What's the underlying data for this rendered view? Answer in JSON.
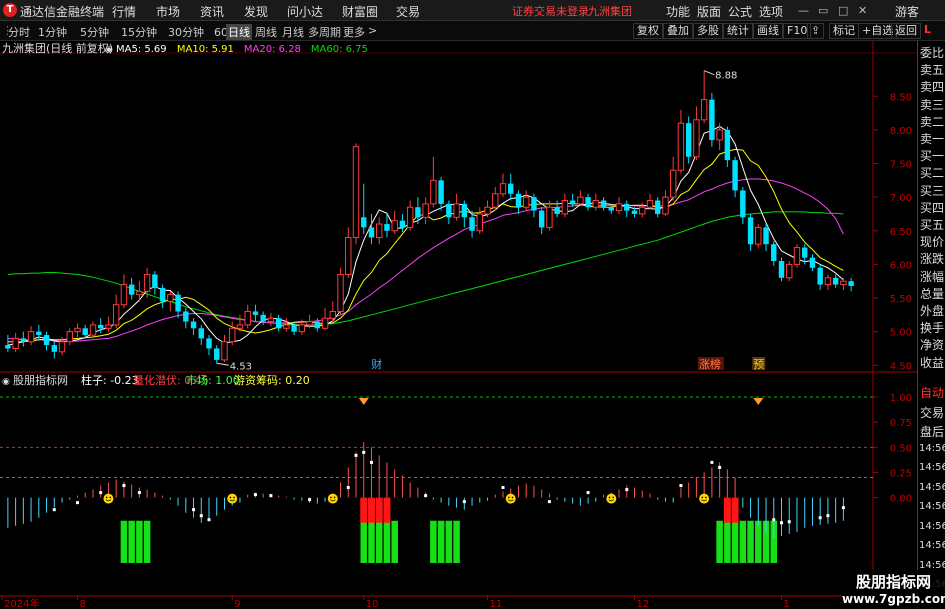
{
  "app": {
    "logo": "T",
    "name": "通达信金融终端"
  },
  "menu": [
    "行情",
    "市场",
    "资讯",
    "发现",
    "问小达",
    "财富圈",
    "交易"
  ],
  "warning": "证券交易未登录",
  "stock_name_top": "九洲集团",
  "right_menu": [
    "功能",
    "版面",
    "公式",
    "选项"
  ],
  "guest": "游客",
  "periods": [
    "分时",
    "1分钟",
    "5分钟",
    "15分钟",
    "30分钟",
    "60分钟",
    "日线",
    "周线",
    "月线",
    "多周期",
    "更多"
  ],
  "selected_period": "日线",
  "more_arrow": ">",
  "right_tools": [
    "复权",
    "叠加",
    "多股",
    "统计",
    "画线",
    "F10",
    "标记",
    "+自选",
    "返回"
  ],
  "chart_title": "九洲集团(日线 前复权)",
  "main_icon": "◉",
  "ma": [
    {
      "label": "MA5: 5.69",
      "color": "#ffffff"
    },
    {
      "label": "MA10: 5.91",
      "color": "#ffff00"
    },
    {
      "label": "MA20: 6.28",
      "color": "#ff40ff"
    },
    {
      "label": "MA60: 6.75",
      "color": "#00dd00"
    }
  ],
  "price_ticks": [
    "8.50",
    "8.00",
    "7.50",
    "7.00",
    "6.50",
    "6.00",
    "5.50",
    "5.00",
    "4.50"
  ],
  "high_label": "8.88",
  "low_label": "4.53",
  "markers": {
    "cai": "财",
    "zhangting": "涨榜",
    "yu": "预"
  },
  "indicator": {
    "name": "股朋指标网",
    "zhuzi": "柱子: -0.23",
    "lh": "量化潜伏: 0.45",
    "sc": "市场: 1.00",
    "yz": "游资筹码: 0.20"
  },
  "ind_ticks": [
    "1.00",
    "0.75",
    "0.50",
    "0.25",
    "0.00"
  ],
  "xaxis": [
    "2024年",
    "8",
    "9",
    "10",
    "11",
    "12",
    "1"
  ],
  "right_panel": [
    "委比",
    "卖五",
    "卖四",
    "卖三",
    "卖二",
    "卖一",
    "买一",
    "买二",
    "买三",
    "买四",
    "买五",
    "现价",
    "涨跌",
    "涨幅",
    "总量",
    "外盘",
    "换手",
    "净资",
    "收益"
  ],
  "right_panel2": [
    "自动",
    "交易",
    "盘后",
    "14:56",
    "14:56",
    "14:56",
    "14:56",
    "14:56",
    "14:56",
    "14:56",
    "14:56"
  ],
  "watermark": {
    "line1": "股朋指标网",
    "line2": "www.7gpzb.com"
  },
  "chart_data": {
    "type": "candlestick",
    "title": "九洲集团(日线 前复权)",
    "ylim": [
      4.4,
      8.95
    ],
    "high": 8.88,
    "low": 4.53,
    "candles": [
      [
        4.8,
        4.75,
        4.95,
        4.7
      ],
      [
        4.75,
        4.9,
        4.98,
        4.7
      ],
      [
        4.9,
        4.85,
        5.0,
        4.78
      ],
      [
        4.85,
        5.0,
        5.08,
        4.8
      ],
      [
        5.0,
        4.95,
        5.1,
        4.88
      ],
      [
        4.95,
        4.8,
        5.0,
        4.72
      ],
      [
        4.8,
        4.7,
        4.85,
        4.6
      ],
      [
        4.7,
        4.85,
        4.92,
        4.65
      ],
      [
        4.85,
        5.0,
        5.05,
        4.8
      ],
      [
        5.0,
        5.05,
        5.12,
        4.92
      ],
      [
        5.05,
        4.95,
        5.1,
        4.9
      ],
      [
        4.95,
        5.1,
        5.15,
        4.9
      ],
      [
        5.1,
        5.05,
        5.2,
        4.98
      ],
      [
        5.05,
        5.1,
        5.22,
        5.0
      ],
      [
        5.1,
        5.4,
        5.55,
        5.05
      ],
      [
        5.4,
        5.7,
        5.85,
        5.35
      ],
      [
        5.7,
        5.55,
        5.8,
        5.48
      ],
      [
        5.55,
        5.6,
        5.75,
        5.45
      ],
      [
        5.6,
        5.85,
        5.95,
        5.5
      ],
      [
        5.85,
        5.65,
        5.9,
        5.55
      ],
      [
        5.65,
        5.45,
        5.7,
        5.35
      ],
      [
        5.45,
        5.55,
        5.6,
        5.3
      ],
      [
        5.55,
        5.3,
        5.6,
        5.2
      ],
      [
        5.3,
        5.15,
        5.35,
        5.05
      ],
      [
        5.15,
        5.05,
        5.2,
        4.95
      ],
      [
        5.05,
        4.9,
        5.1,
        4.8
      ],
      [
        4.9,
        4.75,
        4.95,
        4.65
      ],
      [
        4.75,
        4.58,
        4.8,
        4.53
      ],
      [
        4.58,
        4.85,
        4.95,
        4.55
      ],
      [
        4.85,
        5.05,
        5.15,
        4.8
      ],
      [
        5.05,
        5.1,
        5.25,
        5.0
      ],
      [
        5.1,
        5.3,
        5.4,
        5.05
      ],
      [
        5.3,
        5.25,
        5.4,
        5.15
      ],
      [
        5.25,
        5.15,
        5.3,
        5.1
      ],
      [
        5.15,
        5.2,
        5.28,
        5.08
      ],
      [
        5.2,
        5.05,
        5.25,
        5.0
      ],
      [
        5.05,
        5.1,
        5.2,
        5.0
      ],
      [
        5.1,
        5.0,
        5.15,
        4.95
      ],
      [
        5.0,
        5.1,
        5.18,
        4.95
      ],
      [
        5.1,
        5.15,
        5.25,
        5.05
      ],
      [
        5.15,
        5.05,
        5.2,
        5.0
      ],
      [
        5.05,
        5.2,
        5.35,
        5.02
      ],
      [
        5.2,
        5.3,
        5.45,
        5.15
      ],
      [
        5.3,
        5.85,
        5.95,
        5.25
      ],
      [
        5.85,
        6.4,
        6.55,
        5.8
      ],
      [
        6.4,
        7.75,
        7.8,
        6.3
      ],
      [
        6.7,
        6.55,
        7.2,
        6.45
      ],
      [
        6.55,
        6.4,
        6.75,
        6.3
      ],
      [
        6.4,
        6.6,
        6.7,
        6.3
      ],
      [
        6.6,
        6.5,
        6.75,
        6.4
      ],
      [
        6.5,
        6.65,
        6.8,
        6.45
      ],
      [
        6.65,
        6.55,
        6.75,
        6.48
      ],
      [
        6.55,
        6.85,
        6.95,
        6.5
      ],
      [
        6.85,
        6.7,
        7.0,
        6.6
      ],
      [
        6.7,
        6.9,
        7.0,
        6.6
      ],
      [
        6.9,
        7.25,
        7.6,
        6.85
      ],
      [
        7.25,
        6.9,
        7.3,
        6.8
      ],
      [
        6.9,
        6.7,
        6.95,
        6.6
      ],
      [
        6.7,
        6.9,
        7.05,
        6.65
      ],
      [
        6.9,
        6.7,
        6.95,
        6.55
      ],
      [
        6.7,
        6.5,
        6.8,
        6.4
      ],
      [
        6.5,
        6.75,
        6.85,
        6.45
      ],
      [
        6.75,
        6.85,
        6.95,
        6.7
      ],
      [
        6.85,
        7.05,
        7.15,
        6.8
      ],
      [
        7.05,
        7.2,
        7.35,
        7.0
      ],
      [
        7.2,
        7.05,
        7.35,
        6.95
      ],
      [
        7.05,
        6.85,
        7.1,
        6.75
      ],
      [
        6.85,
        7.0,
        7.1,
        6.8
      ],
      [
        7.0,
        6.8,
        7.05,
        6.7
      ],
      [
        6.8,
        6.55,
        6.85,
        6.45
      ],
      [
        6.55,
        6.85,
        6.95,
        6.5
      ],
      [
        6.85,
        6.75,
        6.95,
        6.7
      ],
      [
        6.75,
        6.95,
        7.05,
        6.7
      ],
      [
        6.95,
        6.9,
        7.05,
        6.85
      ],
      [
        6.9,
        7.0,
        7.1,
        6.88
      ],
      [
        7.0,
        6.85,
        7.05,
        6.8
      ],
      [
        6.85,
        6.95,
        7.05,
        6.8
      ],
      [
        6.95,
        6.85,
        7.0,
        6.8
      ],
      [
        6.85,
        6.8,
        6.9,
        6.75
      ],
      [
        6.8,
        6.9,
        7.0,
        6.75
      ],
      [
        6.9,
        6.8,
        6.95,
        6.7
      ],
      [
        6.8,
        6.75,
        6.85,
        6.7
      ],
      [
        6.75,
        6.85,
        6.92,
        6.7
      ],
      [
        6.85,
        6.95,
        7.05,
        6.82
      ],
      [
        6.95,
        6.75,
        7.0,
        6.7
      ],
      [
        6.75,
        7.0,
        7.1,
        6.72
      ],
      [
        7.0,
        7.4,
        7.6,
        6.95
      ],
      [
        7.4,
        8.1,
        8.3,
        7.35
      ],
      [
        8.1,
        7.6,
        8.2,
        7.5
      ],
      [
        7.6,
        8.15,
        8.35,
        7.55
      ],
      [
        8.15,
        8.45,
        8.88,
        8.1
      ],
      [
        8.45,
        7.85,
        8.55,
        7.75
      ],
      [
        7.85,
        8.0,
        8.1,
        7.7
      ],
      [
        8.0,
        7.55,
        8.05,
        7.45
      ],
      [
        7.55,
        7.1,
        7.6,
        7.0
      ],
      [
        7.1,
        6.7,
        7.15,
        6.6
      ],
      [
        6.7,
        6.3,
        6.75,
        6.2
      ],
      [
        6.3,
        6.55,
        6.6,
        6.25
      ],
      [
        6.55,
        6.3,
        6.6,
        6.2
      ],
      [
        6.3,
        6.05,
        6.35,
        5.98
      ],
      [
        6.05,
        5.8,
        6.1,
        5.75
      ],
      [
        5.8,
        6.0,
        6.05,
        5.75
      ],
      [
        6.0,
        6.25,
        6.3,
        5.95
      ],
      [
        6.25,
        6.1,
        6.3,
        6.0
      ],
      [
        6.1,
        5.95,
        6.15,
        5.9
      ],
      [
        5.95,
        5.7,
        6.0,
        5.62
      ],
      [
        5.7,
        5.8,
        5.85,
        5.62
      ],
      [
        5.8,
        5.7,
        5.85,
        5.65
      ],
      [
        5.7,
        5.75,
        5.8,
        5.62
      ],
      [
        5.75,
        5.68,
        5.8,
        5.6
      ]
    ],
    "ma5": [
      4.8,
      4.82,
      4.85,
      4.88,
      4.92,
      4.9,
      4.86,
      4.85,
      4.86,
      4.88,
      4.91,
      4.98,
      5.03,
      5.06,
      5.13,
      5.26,
      5.36,
      5.47,
      5.62,
      5.67,
      5.62,
      5.61,
      5.5,
      5.41,
      5.3,
      5.19,
      5.03,
      4.9,
      4.83,
      4.85,
      4.87,
      4.95,
      5.07,
      5.17,
      5.2,
      5.19,
      5.15,
      5.1,
      5.09,
      5.08,
      5.08,
      5.1,
      5.16,
      5.31,
      5.56,
      6.04,
      6.36,
      6.6,
      6.81,
      6.76,
      6.54,
      6.54,
      6.61,
      6.65,
      6.73,
      6.79,
      6.84,
      6.89,
      6.89,
      6.89,
      6.74,
      6.71,
      6.74,
      6.81,
      6.91,
      6.98,
      6.99,
      7.03,
      6.99,
      6.9,
      6.82,
      6.8,
      6.78,
      6.8,
      6.89,
      6.89,
      6.93,
      6.91,
      6.89,
      6.88,
      6.86,
      6.83,
      6.83,
      6.83,
      6.82,
      6.86,
      6.99,
      7.24,
      7.37,
      7.65,
      7.95,
      7.99,
      8.05,
      7.98,
      7.79,
      7.44,
      7.1,
      6.89,
      6.62,
      6.38,
      6.2,
      6.14,
      6.08,
      6.04,
      6.06,
      6.0,
      5.95,
      5.87,
      5.77
    ],
    "ma10": [
      4.85,
      4.85,
      4.85,
      4.86,
      4.88,
      4.89,
      4.88,
      4.88,
      4.89,
      4.9,
      4.91,
      4.92,
      4.94,
      4.96,
      5.02,
      5.12,
      5.17,
      5.25,
      5.34,
      5.4,
      5.44,
      5.48,
      5.48,
      5.51,
      5.48,
      5.4,
      5.32,
      5.2,
      5.12,
      5.07,
      5.03,
      5.0,
      4.98,
      5.0,
      5.03,
      5.07,
      5.11,
      5.14,
      5.15,
      5.14,
      5.13,
      5.12,
      5.13,
      5.2,
      5.32,
      5.56,
      5.76,
      5.88,
      6.06,
      6.16,
      6.31,
      6.45,
      6.6,
      6.73,
      6.74,
      6.66,
      6.69,
      6.75,
      6.76,
      6.8,
      6.76,
      6.77,
      6.81,
      6.85,
      6.9,
      6.86,
      6.85,
      6.88,
      6.89,
      6.9,
      6.9,
      6.9,
      6.91,
      6.9,
      6.9,
      6.86,
      6.86,
      6.85,
      6.85,
      6.88,
      6.87,
      6.88,
      6.88,
      6.87,
      6.85,
      6.84,
      6.9,
      7.04,
      7.1,
      7.26,
      7.41,
      7.49,
      7.64,
      7.68,
      7.71,
      7.7,
      7.54,
      7.47,
      7.3,
      7.08,
      6.82,
      6.62,
      6.48,
      6.33,
      6.22,
      6.1,
      6.04,
      5.97,
      5.91
    ],
    "ma20": [
      4.9,
      4.89,
      4.88,
      4.88,
      4.88,
      4.87,
      4.87,
      4.86,
      4.86,
      4.86,
      4.87,
      4.88,
      4.89,
      4.9,
      4.93,
      4.97,
      5.01,
      5.05,
      5.1,
      5.14,
      5.18,
      5.21,
      5.24,
      5.26,
      5.27,
      5.27,
      5.26,
      5.24,
      5.22,
      5.2,
      5.18,
      5.17,
      5.15,
      5.14,
      5.13,
      5.13,
      5.13,
      5.13,
      5.14,
      5.15,
      5.16,
      5.18,
      5.21,
      5.25,
      5.3,
      5.4,
      5.48,
      5.56,
      5.65,
      5.73,
      5.82,
      5.91,
      6.0,
      6.09,
      6.17,
      6.25,
      6.32,
      6.39,
      6.45,
      6.52,
      6.56,
      6.6,
      6.64,
      6.68,
      6.73,
      6.75,
      6.77,
      6.8,
      6.82,
      6.84,
      6.84,
      6.85,
      6.86,
      6.87,
      6.88,
      6.88,
      6.88,
      6.88,
      6.88,
      6.88,
      6.88,
      6.87,
      6.87,
      6.87,
      6.87,
      6.87,
      6.89,
      6.93,
      6.96,
      7.02,
      7.08,
      7.12,
      7.17,
      7.21,
      7.24,
      7.26,
      7.27,
      7.27,
      7.26,
      7.24,
      7.21,
      7.17,
      7.12,
      7.06,
      7.0,
      6.92,
      6.82,
      6.68,
      6.45
    ],
    "ma60": [
      5.85,
      5.86,
      5.86,
      5.87,
      5.87,
      5.88,
      5.88,
      5.87,
      5.86,
      5.85,
      5.83,
      5.81,
      5.78,
      5.75,
      5.72,
      5.68,
      5.64,
      5.6,
      5.56,
      5.52,
      5.48,
      5.45,
      5.41,
      5.37,
      5.34,
      5.31,
      5.28,
      5.25,
      5.23,
      5.21,
      5.19,
      5.17,
      5.15,
      5.14,
      5.13,
      5.12,
      5.11,
      5.1,
      5.1,
      5.1,
      5.1,
      5.11,
      5.12,
      5.14,
      5.16,
      5.19,
      5.22,
      5.25,
      5.28,
      5.31,
      5.34,
      5.37,
      5.4,
      5.43,
      5.46,
      5.49,
      5.52,
      5.55,
      5.58,
      5.61,
      5.64,
      5.67,
      5.7,
      5.73,
      5.76,
      5.79,
      5.82,
      5.85,
      5.88,
      5.91,
      5.94,
      5.97,
      6.0,
      6.03,
      6.06,
      6.09,
      6.12,
      6.15,
      6.18,
      6.21,
      6.24,
      6.27,
      6.3,
      6.33,
      6.36,
      6.4,
      6.44,
      6.48,
      6.52,
      6.56,
      6.6,
      6.64,
      6.67,
      6.7,
      6.72,
      6.74,
      6.75,
      6.76,
      6.77,
      6.78,
      6.78,
      6.78,
      6.78,
      6.78,
      6.77,
      6.77,
      6.76,
      6.76,
      6.75
    ],
    "indicator_ylim": [
      -0.7,
      1.1
    ],
    "zhuzi": [
      -0.3,
      -0.28,
      -0.26,
      -0.24,
      -0.2,
      -0.15,
      -0.1,
      -0.05,
      -0.02,
      0.02,
      0.05,
      0.08,
      0.12,
      0.15,
      0.18,
      0.16,
      0.13,
      0.1,
      0.08,
      0.05,
      0.02,
      -0.02,
      -0.08,
      -0.15,
      -0.2,
      -0.25,
      -0.22,
      -0.18,
      -0.12,
      -0.08,
      -0.05,
      0.03,
      0.05,
      0.04,
      0.03,
      0.02,
      0.01,
      -0.02,
      -0.03,
      -0.05,
      -0.06,
      -0.04,
      -0.02,
      0.15,
      0.3,
      0.45,
      0.55,
      0.5,
      0.42,
      0.35,
      0.28,
      0.22,
      0.15,
      0.1,
      0.05,
      -0.02,
      -0.05,
      -0.08,
      -0.1,
      -0.12,
      -0.08,
      -0.05,
      -0.03,
      0.03,
      0.06,
      0.09,
      0.12,
      0.14,
      0.12,
      0.08,
      0.04,
      -0.02,
      -0.04,
      -0.06,
      -0.08,
      -0.06,
      -0.04,
      0.03,
      0.05,
      0.08,
      0.12,
      0.1,
      0.07,
      0.04,
      -0.02,
      -0.04,
      -0.05,
      0.1,
      0.15,
      0.2,
      0.25,
      0.3,
      0.35,
      0.28,
      0.2,
      -0.1,
      -0.2,
      -0.28,
      -0.35,
      -0.4,
      -0.38,
      -0.36,
      -0.34,
      -0.3,
      -0.28,
      -0.27,
      -0.26,
      -0.25,
      -0.23
    ],
    "lhqf": [
      null,
      null,
      null,
      null,
      null,
      null,
      -0.12,
      null,
      null,
      -0.05,
      null,
      null,
      0.05,
      null,
      null,
      0.12,
      null,
      0.05,
      null,
      null,
      null,
      null,
      null,
      null,
      -0.12,
      -0.18,
      -0.22,
      null,
      null,
      null,
      null,
      null,
      0.03,
      null,
      0.02,
      null,
      null,
      null,
      null,
      -0.02,
      null,
      null,
      null,
      null,
      0.1,
      0.42,
      0.45,
      0.35,
      null,
      null,
      null,
      null,
      null,
      null,
      0.02,
      null,
      null,
      null,
      null,
      -0.04,
      null,
      null,
      null,
      null,
      0.1,
      null,
      null,
      null,
      null,
      null,
      -0.04,
      null,
      null,
      null,
      null,
      0.05,
      null,
      null,
      null,
      null,
      0.08,
      null,
      null,
      null,
      null,
      null,
      null,
      0.12,
      null,
      null,
      null,
      0.35,
      0.3,
      null,
      null,
      null,
      null,
      null,
      null,
      -0.22,
      -0.25,
      -0.24,
      null,
      null,
      null,
      -0.2,
      -0.18,
      null,
      -0.1
    ],
    "red_bars": [
      46,
      47,
      48,
      49,
      93,
      94
    ],
    "green_bars": [
      [
        15,
        18
      ],
      [
        46,
        50
      ],
      [
        55,
        58
      ],
      [
        92,
        94
      ],
      [
        95,
        99
      ]
    ],
    "smileys": [
      13,
      29,
      42,
      65,
      78,
      90
    ],
    "diamonds": [
      46,
      97
    ],
    "tick_labels_x": {
      "2024年": 0,
      "8": 9,
      "9": 29,
      "10": 46,
      "11": 62,
      "12": 81,
      "1": 100
    }
  }
}
